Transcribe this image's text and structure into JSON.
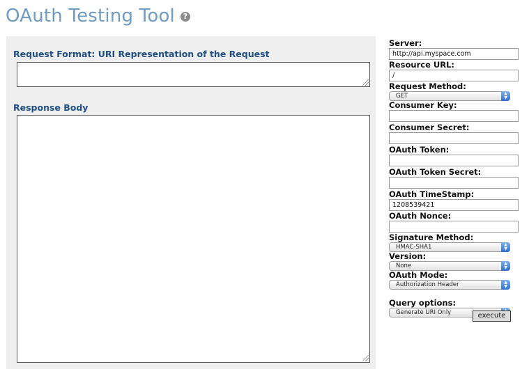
{
  "page": {
    "title": "OAuth Testing Tool",
    "help_icon": "question-icon"
  },
  "main": {
    "request_label": "Request Format: URI Representation of the Request",
    "request_value": "",
    "response_label": "Response Body",
    "response_value": ""
  },
  "form": {
    "server_label": "Server:",
    "server_value": "http://api.myspace.com",
    "resource_label": "Resource URL:",
    "resource_value": "/",
    "method_label": "Request Method:",
    "method_value": "GET",
    "consumer_key_label": "Consumer Key:",
    "consumer_key_value": "",
    "consumer_secret_label": "Consumer Secret:",
    "consumer_secret_value": "",
    "token_label": "OAuth Token:",
    "token_value": "",
    "token_secret_label": "OAuth Token Secret:",
    "token_secret_value": "",
    "timestamp_label": "OAuth TimeStamp:",
    "timestamp_value": "1208539421",
    "nonce_label": "OAuth Nonce:",
    "nonce_value": "",
    "signature_label": "Signature Method:",
    "signature_value": "HMAC-SHA1",
    "version_label": "Version:",
    "version_value": "None",
    "mode_label": "OAuth Mode:",
    "mode_value": "Authorization Header",
    "query_label": "Query options:",
    "query_value": "Generate URI Only",
    "execute_label": "execute"
  },
  "colors": {
    "title": "#6f9bc7",
    "section_label": "#1f4f86",
    "panel_bg": "#efefef"
  }
}
